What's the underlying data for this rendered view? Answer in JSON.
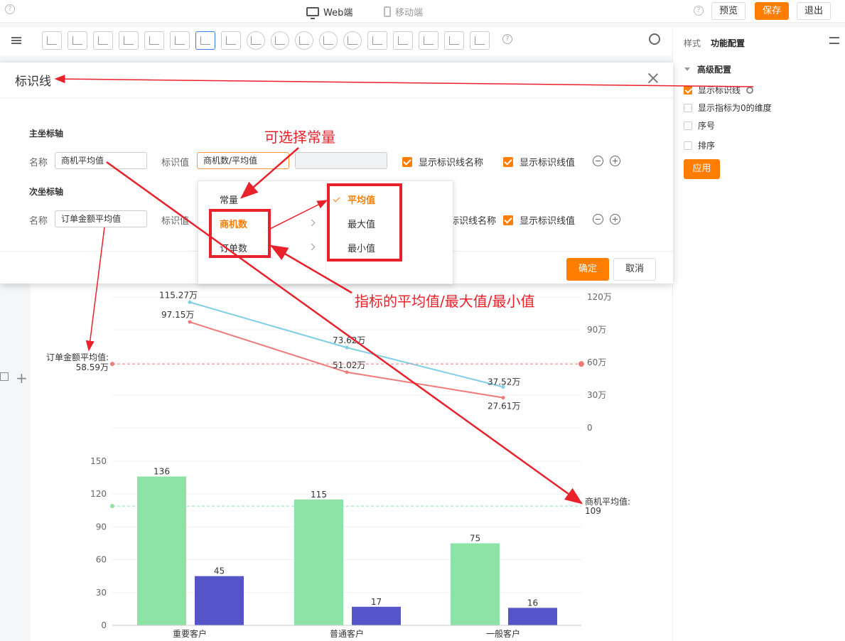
{
  "topbar": {
    "help": "?",
    "web_label": "Web端",
    "mobile_label": "移动端",
    "preview": "预览",
    "save": "保存",
    "exit": "退出"
  },
  "toolbar": {
    "help": "?"
  },
  "right_panel": {
    "tab_style": "样式",
    "tab_function": "功能配置",
    "section": "高级配置",
    "options": [
      {
        "label": "显示标识线",
        "checked": true
      },
      {
        "label": "显示指标为0的维度",
        "checked": false
      },
      {
        "label": "序号",
        "checked": false
      },
      {
        "label": "排序",
        "checked": false
      }
    ],
    "apply": "应用"
  },
  "modal": {
    "title": "标识线",
    "primary_axis": "主坐标轴",
    "secondary_axis": "次坐标轴",
    "name_label": "名称",
    "value_label": "标识值",
    "primary_name": "商机平均值",
    "primary_value": "商机数/平均值",
    "secondary_name": "订单金额平均值",
    "show_name": "显示标识线名称",
    "show_name_partial": "示标识线名称",
    "show_value": "显示标识线值",
    "ok": "确定",
    "cancel": "取消"
  },
  "dropdown": {
    "col1": [
      "常量",
      "商机数",
      "订单数"
    ],
    "col2": [
      "平均值",
      "最大值",
      "最小值"
    ]
  },
  "annotations": {
    "constant": "可选择常量",
    "metric": "指标的平均值/最大值/最小值"
  },
  "chart_data": {
    "type": "bar",
    "categories": [
      "重要客户",
      "普通客户",
      "一般客户"
    ],
    "line_chart": {
      "type": "line",
      "y_ticks": [
        "120万",
        "90万",
        "60万",
        "30万",
        "0"
      ],
      "series": [
        {
          "values": [
            115.27,
            73.62,
            37.52
          ],
          "labels": [
            "115.27万",
            "73.62万",
            "37.52万"
          ],
          "color": "#7ecfe6"
        },
        {
          "values": [
            97.15,
            51.02,
            27.61
          ],
          "labels": [
            "97.15万",
            "51.02万",
            "27.61万"
          ],
          "color": "#f07a7a"
        }
      ],
      "markline": {
        "value": 58.59,
        "label_line1": "订单金额平均值:",
        "label_line2": "58.59万",
        "color": "#f07a7a"
      },
      "ylim": [
        0,
        120
      ]
    },
    "bar_chart": {
      "y_ticks": [
        "150",
        "120",
        "90",
        "60",
        "30",
        "0"
      ],
      "series": [
        {
          "values": [
            136,
            115,
            75
          ],
          "color": "#8de3a6"
        },
        {
          "values": [
            45,
            17,
            16
          ],
          "color": "#5555c8"
        }
      ],
      "markline": {
        "value": 109,
        "label_line1": "商机平均值:",
        "label_line2": "109",
        "color": "#8de3a6"
      },
      "ylim": [
        0,
        150
      ]
    }
  }
}
